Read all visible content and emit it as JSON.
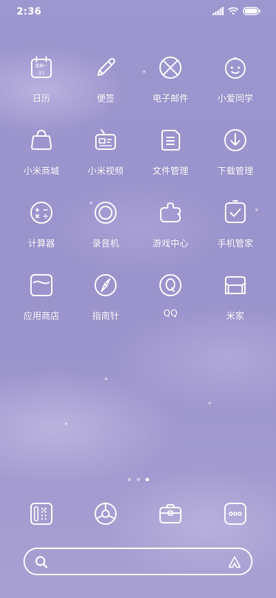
{
  "status_bar": {
    "time": "2:36",
    "icons": [
      "signal-icon",
      "wifi-icon",
      "battery-icon"
    ]
  },
  "apps": [
    {
      "label": "日历",
      "icon": "calendar-icon",
      "calendar_text": "星期一",
      "calendar_day": "31"
    },
    {
      "label": "便签",
      "icon": "notes-pen-icon"
    },
    {
      "label": "电子邮件",
      "icon": "email-icon"
    },
    {
      "label": "小爱同学",
      "icon": "xiaoai-face-icon"
    },
    {
      "label": "小米商城",
      "icon": "shopping-bag-icon"
    },
    {
      "label": "小米视频",
      "icon": "tv-video-icon"
    },
    {
      "label": "文件管理",
      "icon": "file-manager-icon"
    },
    {
      "label": "下载管理",
      "icon": "download-icon"
    },
    {
      "label": "计算器",
      "icon": "calculator-icon"
    },
    {
      "label": "录音机",
      "icon": "recorder-icon"
    },
    {
      "label": "游戏中心",
      "icon": "game-center-icon"
    },
    {
      "label": "手机管家",
      "icon": "security-check-icon"
    },
    {
      "label": "应用商店",
      "icon": "app-store-icon"
    },
    {
      "label": "指南针",
      "icon": "compass-icon"
    },
    {
      "label": "QQ",
      "icon": "qq-icon"
    },
    {
      "label": "米家",
      "icon": "mijia-sofa-icon"
    }
  ],
  "page_indicator": {
    "count": 3,
    "active": 3
  },
  "dock": [
    "phone-dialer-icon",
    "browser-icon",
    "camera-icon",
    "messages-icon"
  ],
  "search": {
    "left_icon": "search-icon",
    "right_icon": "assistant-icon"
  },
  "colors": {
    "background": "#9d97cf",
    "foreground": "#ffffff"
  }
}
